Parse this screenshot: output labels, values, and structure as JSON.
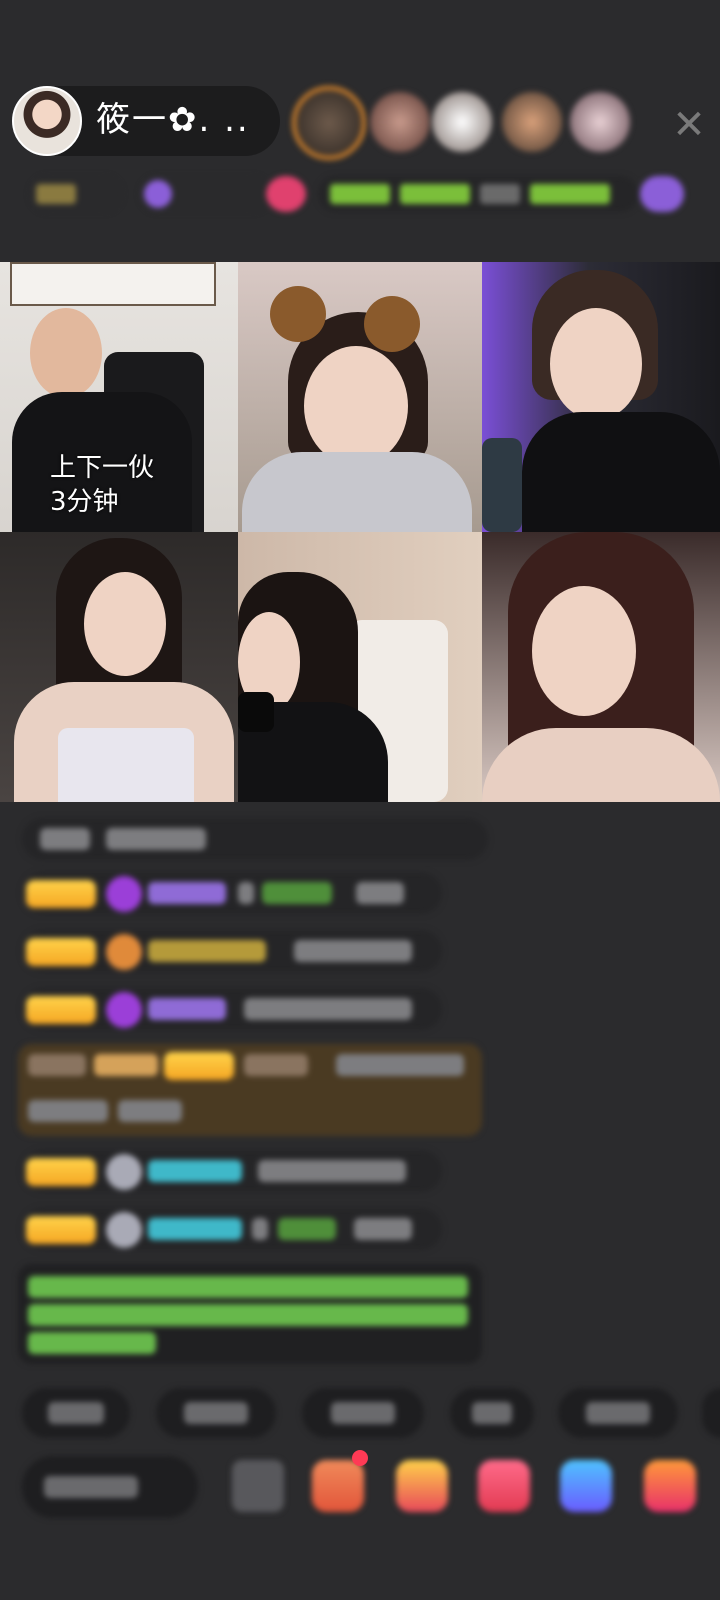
{
  "header": {
    "host_name": "筱一✿. ..",
    "close_icon": "✕"
  },
  "video_grid": {
    "cell_1_caption_line1": "上下一伙",
    "cell_1_caption_line2": "3分钟"
  },
  "colors": {
    "background": "#2b2b2d",
    "level_badge": "#f5b52a",
    "announcement_text": "#67b84b",
    "chat_nick_purple": "#8f6bd6",
    "chat_nick_cyan": "#3fb8c9"
  }
}
